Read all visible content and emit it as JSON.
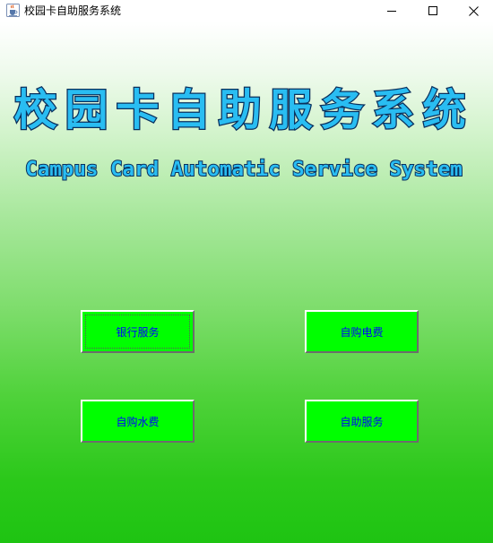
{
  "window": {
    "title": "校园卡自助服务系统",
    "icon": "java-cup-icon",
    "controls": {
      "minimize_icon": "minimize-icon",
      "maximize_icon": "maximize-icon",
      "close_icon": "close-icon"
    }
  },
  "headline": {
    "chinese": "校园卡自助服务系统",
    "english": "Campus Card Automatic Service System"
  },
  "buttons": {
    "bank_service": "银行服务",
    "buy_electricity": "自购电费",
    "buy_water": "自购水费",
    "self_service": "自助服务"
  },
  "colors": {
    "background_top": "#ffffff",
    "background_bottom": "#1ec412",
    "button_fill": "#00ff00",
    "button_text": "#0000ff",
    "headline_fill": "#29bdf2",
    "headline_outline": "#0a2f5c"
  }
}
